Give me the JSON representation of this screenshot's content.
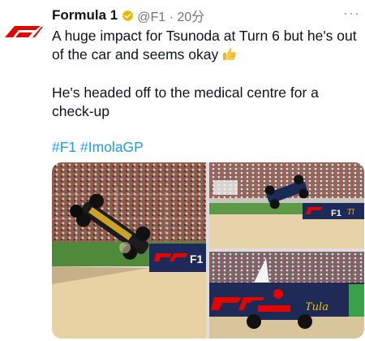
{
  "tweet": {
    "author_name": "Formula 1",
    "handle_time": "@F1 · 20分",
    "body_line1": "A huge impact for Tsunoda at Turn 6 but he's out of the car and seems okay",
    "body_line2": "He's headed off to the medical centre for a check-up",
    "hashtags": [
      "#F1",
      "#ImolaGP"
    ],
    "more_label": "···"
  },
  "avatar": {
    "logo_text": "F1",
    "color": "#e10600"
  },
  "icons": {
    "verified": "verified-badge-icon",
    "thumbs_up": "thumbs-up-emoji",
    "more": "more-icon"
  },
  "colors": {
    "hashtag": "#1d9bf0",
    "verified": "#f1b300",
    "f1_red": "#e10600"
  },
  "media": {
    "photos": [
      {
        "id": "crash-photo-1",
        "banner_text": "F1"
      },
      {
        "id": "crash-photo-2",
        "banner_text": "F1"
      },
      {
        "id": "crash-photo-3",
        "banner_text": "F1"
      }
    ]
  }
}
